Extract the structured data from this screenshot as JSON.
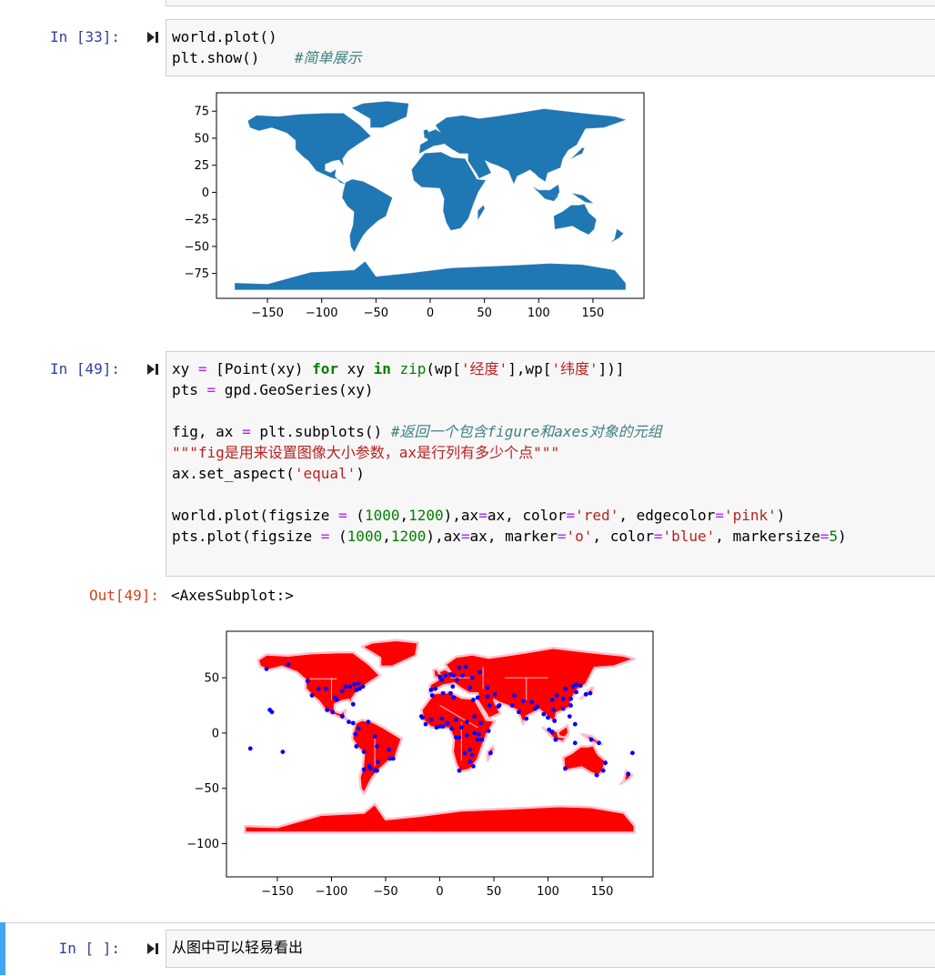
{
  "cells": [
    {
      "prompt": "In  [33]:",
      "lines": [
        [
          {
            "t": "world.plot()",
            "c": ""
          }
        ],
        [
          {
            "t": "plt.show()    ",
            "c": ""
          },
          {
            "t": "#简单展示",
            "c": "cmt"
          }
        ]
      ]
    },
    {
      "prompt": "In  [49]:",
      "lines": [
        [
          {
            "t": "xy ",
            "c": ""
          },
          {
            "t": "=",
            "c": "op"
          },
          {
            "t": " [Point(xy) ",
            "c": ""
          },
          {
            "t": "for",
            "c": "kw"
          },
          {
            "t": " xy ",
            "c": ""
          },
          {
            "t": "in",
            "c": "kw"
          },
          {
            "t": " ",
            "c": ""
          },
          {
            "t": "zip",
            "c": "fn"
          },
          {
            "t": "(wp[",
            "c": ""
          },
          {
            "t": "'经度'",
            "c": "str"
          },
          {
            "t": "],wp[",
            "c": ""
          },
          {
            "t": "'纬度'",
            "c": "str"
          },
          {
            "t": "])]",
            "c": ""
          }
        ],
        [
          {
            "t": "pts ",
            "c": ""
          },
          {
            "t": "=",
            "c": "op"
          },
          {
            "t": " gpd.GeoSeries(xy)",
            "c": ""
          }
        ],
        [],
        [
          {
            "t": "fig, ax ",
            "c": ""
          },
          {
            "t": "=",
            "c": "op"
          },
          {
            "t": " plt.subplots() ",
            "c": ""
          },
          {
            "t": "#返回一个包含figure和axes对象的元组",
            "c": "cmt"
          }
        ],
        [
          {
            "t": "\"\"\"fig是用来设置图像大小参数，ax是行列有多少个点\"\"\"",
            "c": "str"
          }
        ],
        [
          {
            "t": "ax.set_aspect(",
            "c": ""
          },
          {
            "t": "'equal'",
            "c": "str"
          },
          {
            "t": ")",
            "c": ""
          }
        ],
        [],
        [
          {
            "t": "world.plot(figsize ",
            "c": ""
          },
          {
            "t": "=",
            "c": "op"
          },
          {
            "t": " (",
            "c": ""
          },
          {
            "t": "1000",
            "c": "num"
          },
          {
            "t": ",",
            "c": ""
          },
          {
            "t": "1200",
            "c": "num"
          },
          {
            "t": "),ax",
            "c": ""
          },
          {
            "t": "=",
            "c": "op"
          },
          {
            "t": "ax, color",
            "c": ""
          },
          {
            "t": "=",
            "c": "op"
          },
          {
            "t": "'red'",
            "c": "str"
          },
          {
            "t": ", edgecolor",
            "c": ""
          },
          {
            "t": "=",
            "c": "op"
          },
          {
            "t": "'pink'",
            "c": "str"
          },
          {
            "t": ")",
            "c": ""
          }
        ],
        [
          {
            "t": "pts.plot(figsize ",
            "c": ""
          },
          {
            "t": "=",
            "c": "op"
          },
          {
            "t": " (",
            "c": ""
          },
          {
            "t": "1000",
            "c": "num"
          },
          {
            "t": ",",
            "c": ""
          },
          {
            "t": "1200",
            "c": "num"
          },
          {
            "t": "),ax",
            "c": ""
          },
          {
            "t": "=",
            "c": "op"
          },
          {
            "t": "ax, marker",
            "c": ""
          },
          {
            "t": "=",
            "c": "op"
          },
          {
            "t": "'o'",
            "c": "str"
          },
          {
            "t": ", color",
            "c": ""
          },
          {
            "t": "=",
            "c": "op"
          },
          {
            "t": "'blue'",
            "c": "str"
          },
          {
            "t": ", markersize",
            "c": ""
          },
          {
            "t": "=",
            "c": "op"
          },
          {
            "t": "5",
            "c": "num"
          },
          {
            "t": ")",
            "c": ""
          }
        ]
      ],
      "out_prompt": "Out[49]:",
      "out_text": "<AxesSubplot:>"
    },
    {
      "prompt": "In  [ ]:",
      "lines": [
        [
          {
            "t": "从图中可以轻易看出",
            "c": ""
          }
        ]
      ]
    }
  ],
  "chart_data": [
    {
      "type": "map",
      "fill_color": "#1f77b4",
      "xticks": [
        "−150",
        "−100",
        "−50",
        "0",
        "50",
        "100",
        "150"
      ],
      "yticks": [
        "75",
        "50",
        "25",
        "0",
        "−25",
        "−50",
        "−75"
      ],
      "xlim": [
        -197,
        197
      ],
      "ylim": [
        -98,
        92
      ]
    },
    {
      "type": "map",
      "fill_color": "#ff0000",
      "edge_color": "#ffc0cb",
      "point_color": "#0000ff",
      "xticks": [
        "−150",
        "−100",
        "−50",
        "0",
        "50",
        "100",
        "150"
      ],
      "yticks": [
        "50",
        "0",
        "−50",
        "−100"
      ],
      "xlim": [
        -197,
        197
      ],
      "ylim": [
        -130,
        92
      ]
    }
  ]
}
